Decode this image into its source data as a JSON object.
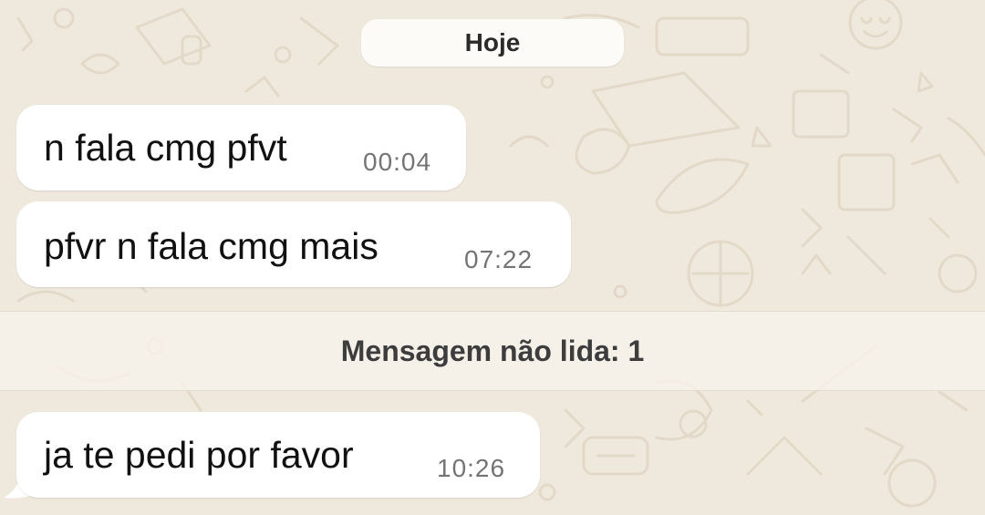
{
  "chat": {
    "date_label": "Hoje",
    "messages_before": [
      {
        "text": "n fala cmg pfvt",
        "time": "00:04"
      },
      {
        "text": "pfvr n fala cmg mais",
        "time": "07:22"
      }
    ],
    "unread_banner": "Mensagem não lida: 1",
    "messages_after": [
      {
        "text": "ja te pedi por favor",
        "time": "10:26"
      }
    ]
  },
  "colors": {
    "wallpaper": "#efe8dc",
    "bubble_incoming": "#ffffff",
    "timestamp_text": "#747474",
    "message_text": "#111111"
  },
  "icons": [
    "wallpaper-doodle-pattern"
  ]
}
